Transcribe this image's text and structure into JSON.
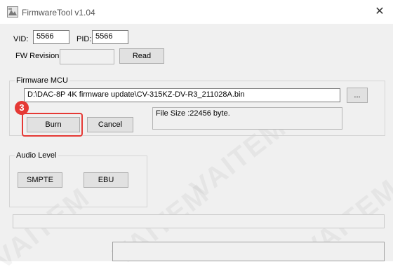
{
  "window": {
    "title": "FirmwareTool v1.04"
  },
  "ids": {
    "vid_label": "VID:",
    "vid_value": "5566",
    "pid_label": "PID:",
    "pid_value": "5566"
  },
  "fw": {
    "revision_label": "FW Revision:",
    "revision_value": "",
    "read_label": "Read"
  },
  "firmware_mcu": {
    "group_label": "Firmware MCU",
    "path": "D:\\DAC-8P 4K firmware update\\CV-315KZ-DV-R3_211028A.bin",
    "browse_label": "...",
    "file_size_text": "File Size :22456 byte.",
    "burn_label": "Burn",
    "cancel_label": "Cancel"
  },
  "annotation": {
    "step_number": "3",
    "color": "#e53935"
  },
  "audio_level": {
    "group_label": "Audio Level",
    "smpte_label": "SMPTE",
    "ebu_label": "EBU"
  },
  "watermark": {
    "text": "VAITEM"
  }
}
